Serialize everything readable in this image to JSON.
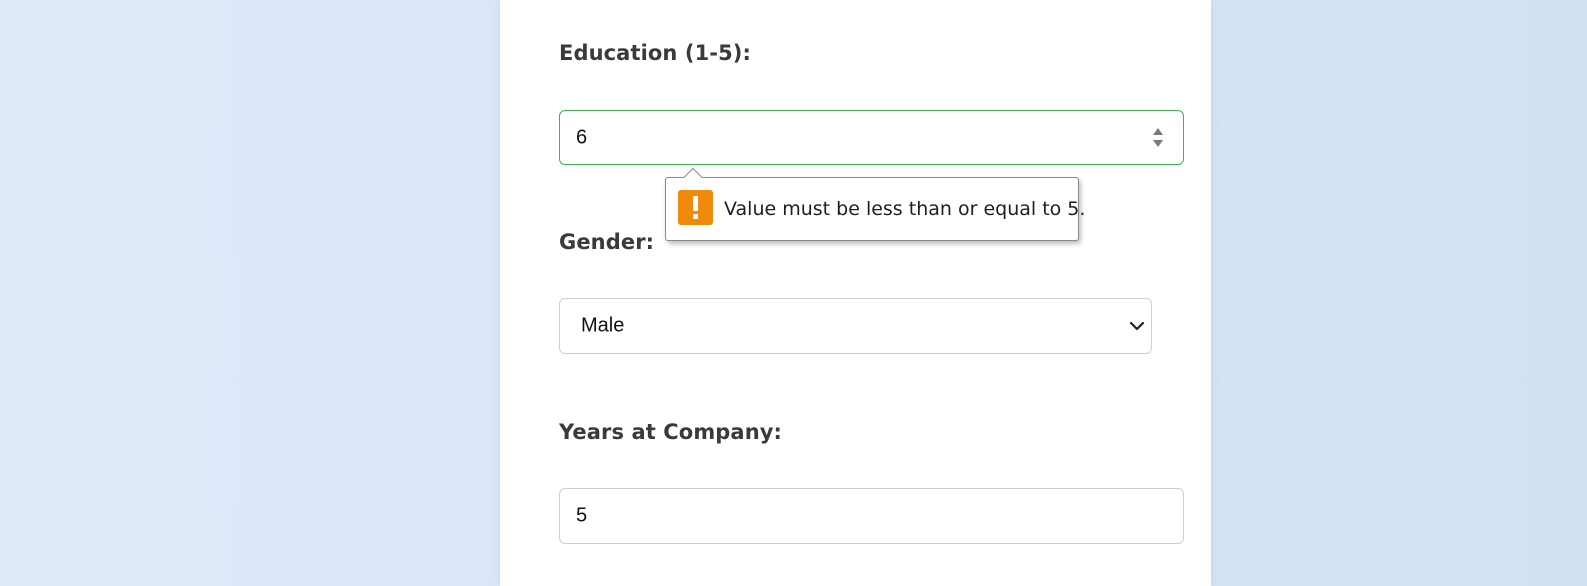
{
  "form": {
    "education": {
      "label": "Education (1-5):",
      "value": "6"
    },
    "gender": {
      "label": "Gender:",
      "selected": "Male"
    },
    "years": {
      "label": "Years at Company:",
      "value": "5"
    }
  },
  "validation": {
    "message": "Value must be less than or equal to 5.",
    "icon": "warning-icon"
  },
  "colors": {
    "valid_border": "#3fb449",
    "warning": "#f08a0c"
  }
}
